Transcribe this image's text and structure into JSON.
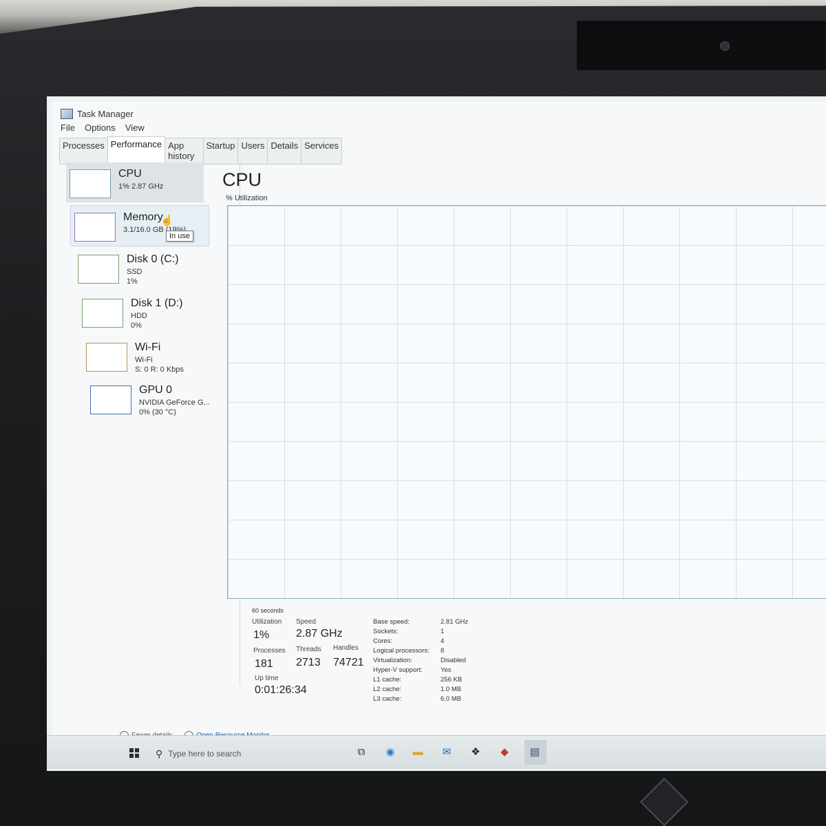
{
  "window": {
    "title": "Task Manager"
  },
  "menu": [
    "File",
    "Options",
    "View"
  ],
  "tabs": [
    "Processes",
    "Performance",
    "App history",
    "Startup",
    "Users",
    "Details",
    "Services"
  ],
  "active_tab": "Performance",
  "sidebar": {
    "items": [
      {
        "title": "CPU",
        "sub1": "1% 2.87 GHz",
        "sub2": ""
      },
      {
        "title": "Memory",
        "sub1": "3.1/16.0 GB (19%)",
        "sub2": ""
      },
      {
        "title": "Disk 0 (C:)",
        "sub1": "SSD",
        "sub2": "1%"
      },
      {
        "title": "Disk 1 (D:)",
        "sub1": "HDD",
        "sub2": "0%"
      },
      {
        "title": "Wi-Fi",
        "sub1": "Wi-Fi",
        "sub2": "S: 0 R: 0 Kbps"
      },
      {
        "title": "GPU 0",
        "sub1": "NVIDIA GeForce G...",
        "sub2": "0% (30 °C)"
      }
    ],
    "tooltip": "In use"
  },
  "main": {
    "title": "CPU",
    "util_label": "% Utilization",
    "time_label": "60 seconds",
    "stats": {
      "utilization_label": "Utilization",
      "utilization": "1%",
      "speed_label": "Speed",
      "speed": "2.87 GHz",
      "processes_label": "Processes",
      "processes": "181",
      "threads_label": "Threads",
      "threads": "2713",
      "handles_label": "Handles",
      "handles": "74721",
      "uptime_label": "Up time",
      "uptime": "0:01:26:34"
    },
    "specs": [
      {
        "k": "Base speed:",
        "v": "2.81 GHz"
      },
      {
        "k": "Sockets:",
        "v": "1"
      },
      {
        "k": "Cores:",
        "v": "4"
      },
      {
        "k": "Logical processors:",
        "v": "8"
      },
      {
        "k": "Virtualization:",
        "v": "Disabled"
      },
      {
        "k": "Hyper-V support:",
        "v": "Yes"
      },
      {
        "k": "L1 cache:",
        "v": "256 KB"
      },
      {
        "k": "L2 cache:",
        "v": "1.0 MB"
      },
      {
        "k": "L3 cache:",
        "v": "6.0 MB"
      }
    ]
  },
  "footer": {
    "fewer_details": "Fewer details",
    "open_monitor": "Open Resource Monitor"
  },
  "taskbar": {
    "search_placeholder": "Type here to search",
    "icons": [
      "task-view-icon",
      "edge-icon",
      "file-explorer-icon",
      "mail-icon",
      "dropbox-icon",
      "app-icon",
      "task-manager-icon"
    ]
  }
}
